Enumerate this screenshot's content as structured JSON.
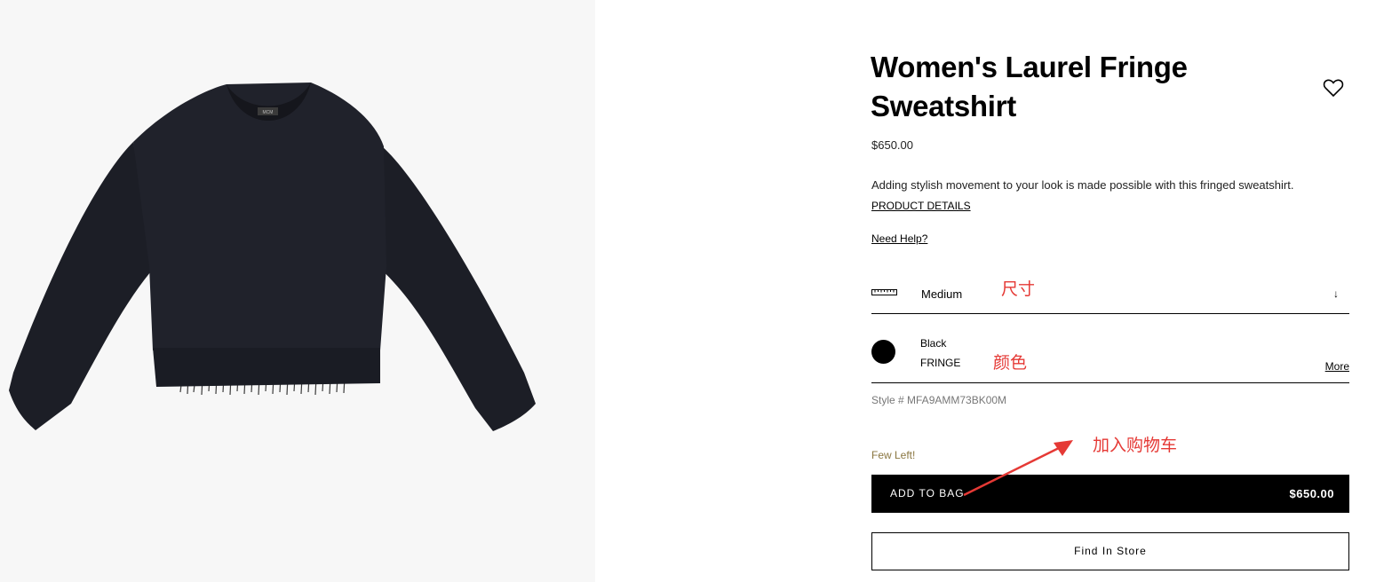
{
  "product": {
    "title": "Women's Laurel Fringe Sweatshirt",
    "price": "$650.00",
    "description": "Adding stylish movement to your look is made possible with this fringed sweatshirt.",
    "details_link": "PRODUCT DETAILS",
    "help_link": "Need Help?",
    "size": {
      "value": "Medium",
      "arrow": "↓"
    },
    "color": {
      "name": "Black",
      "variant": "FRINGE",
      "more": "More",
      "swatch": "#000000"
    },
    "style_number": "Style # MFA9AMM73BK00M",
    "stock_status": "Few Left!",
    "add_to_bag": {
      "label": "ADD TO BAG",
      "price": "$650.00"
    },
    "find_in_store": "Find In Store",
    "tag_text": "MCM"
  },
  "annotations": {
    "size": "尺寸",
    "color": "颜色",
    "add_to_cart": "加入购物车",
    "color_hex": "#e53935"
  },
  "colors": {
    "stock": "#8a7640",
    "image_bg": "#f7f7f7",
    "garment": "#1c1e26"
  }
}
